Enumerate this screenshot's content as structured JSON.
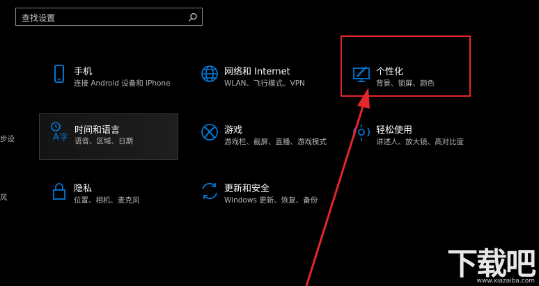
{
  "search": {
    "placeholder": "查找设置"
  },
  "tiles": [
    {
      "id": "phone",
      "title": "手机",
      "desc": "连接 Android 设备和 iPhone",
      "icon": "phone-icon"
    },
    {
      "id": "network",
      "title": "网络和 Internet",
      "desc": "WLAN、飞行模式、VPN",
      "icon": "globe-icon"
    },
    {
      "id": "personalization",
      "title": "个性化",
      "desc": "背景、锁屏、颜色",
      "icon": "personalization-icon"
    },
    {
      "id": "time-language",
      "title": "时间和语言",
      "desc": "语音、区域、日期",
      "icon": "time-language-icon"
    },
    {
      "id": "gaming",
      "title": "游戏",
      "desc": "游戏栏、截屏、直播、游戏模式",
      "icon": "xbox-icon"
    },
    {
      "id": "ease-of-access",
      "title": "轻松使用",
      "desc": "讲述人、放大镜、高对比度",
      "icon": "ease-of-access-icon"
    },
    {
      "id": "privacy",
      "title": "隐私",
      "desc": "位置、相机、麦克风",
      "icon": "lock-icon"
    },
    {
      "id": "update-security",
      "title": "更新和安全",
      "desc": "Windows 更新、恢复、备份",
      "icon": "refresh-icon"
    }
  ],
  "edge_fragments": [
    "步设",
    "风"
  ],
  "watermark": {
    "big": "下载吧",
    "small": "www.xiazaiba.com"
  },
  "colors": {
    "accent": "#0078d7",
    "annotation": "#e5262a",
    "background": "#000000"
  }
}
